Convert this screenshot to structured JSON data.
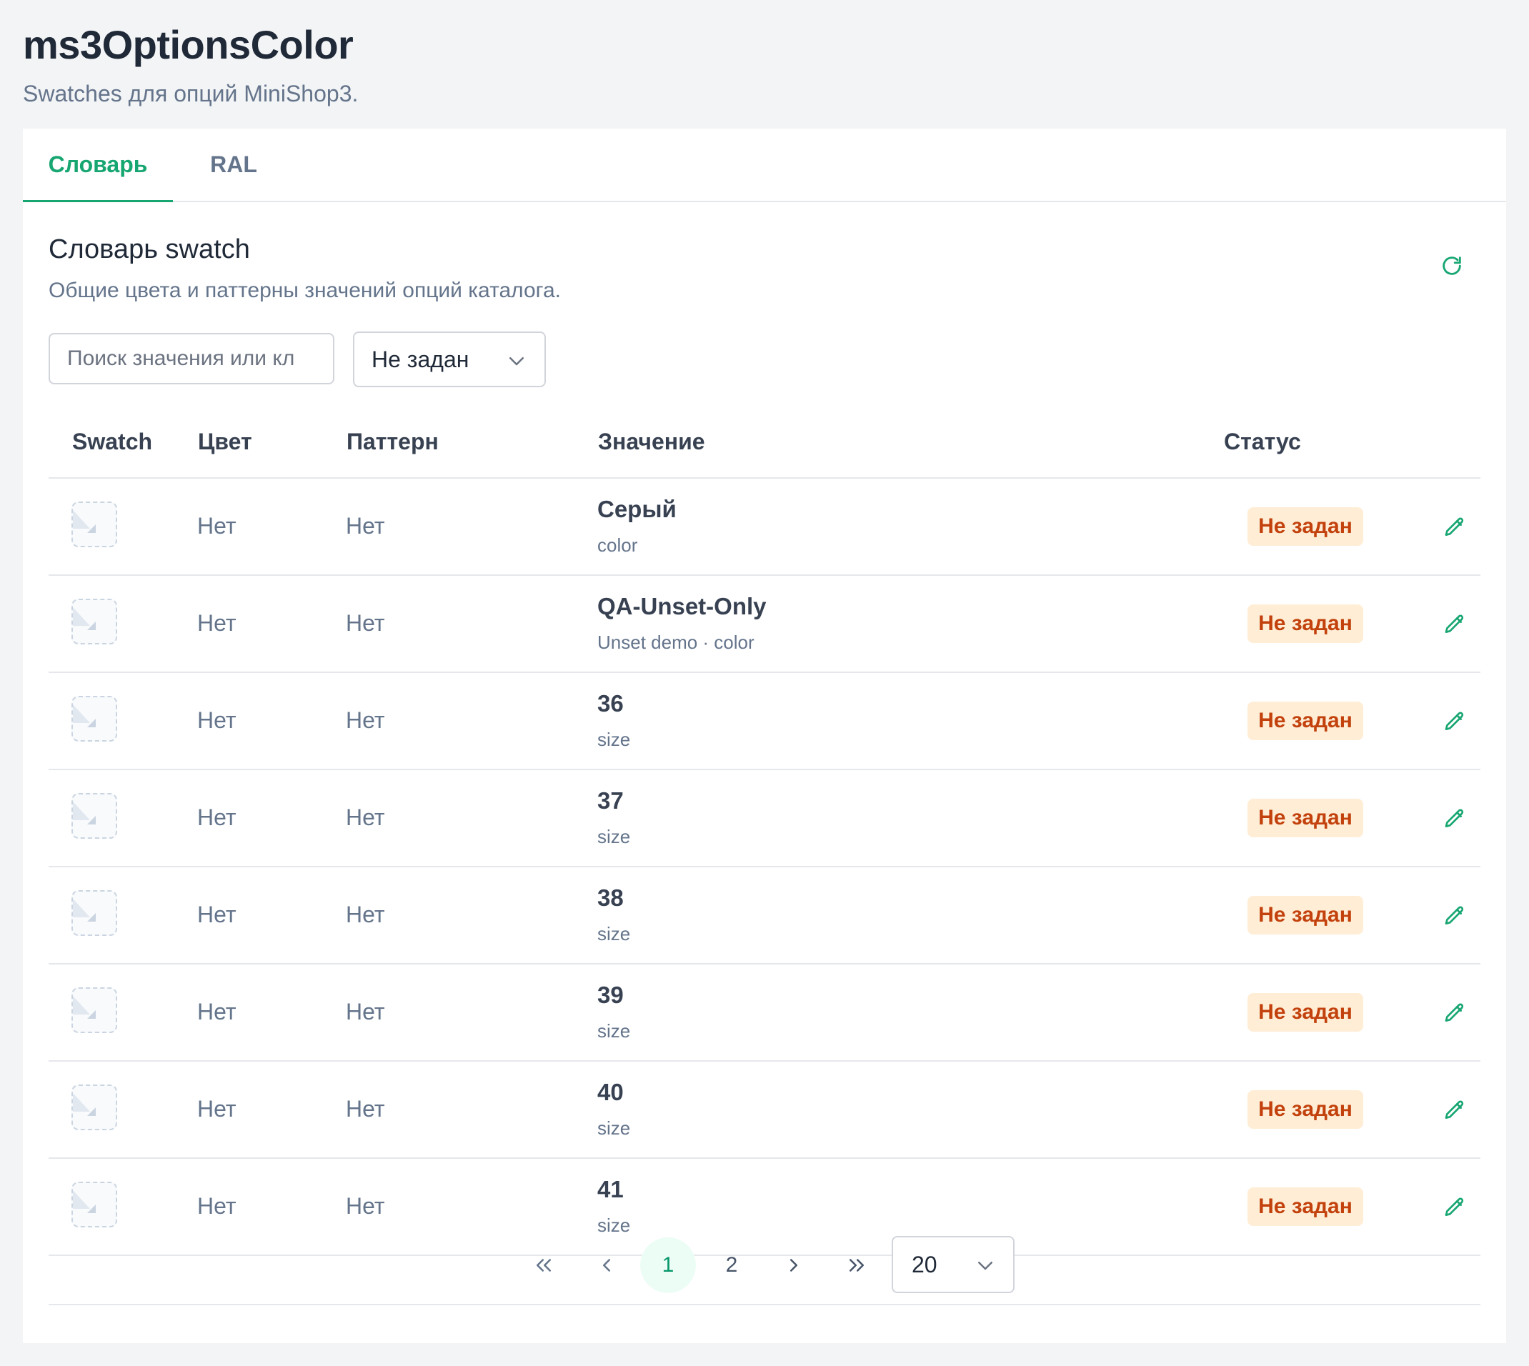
{
  "header": {
    "title": "ms3OptionsColor",
    "subtitle": "Swatches для опций MiniShop3."
  },
  "tabs": [
    {
      "label": "Словарь",
      "active": true
    },
    {
      "label": "RAL",
      "active": false
    }
  ],
  "section": {
    "title": "Словарь swatch",
    "description": "Общие цвета и паттерны значений опций каталога.",
    "refresh_icon": "refresh-icon"
  },
  "filters": {
    "search_placeholder": "Поиск значения или кл",
    "search_value": "",
    "status_selected": "Не задан",
    "dropdown_icon": "chevron-down-icon"
  },
  "table": {
    "columns": [
      "Swatch",
      "Цвет",
      "Паттерн",
      "Значение",
      "Статус"
    ],
    "rows": [
      {
        "color": "Нет",
        "pattern": "Нет",
        "value": "Серый",
        "meta": "color",
        "status": "Не задан"
      },
      {
        "color": "Нет",
        "pattern": "Нет",
        "value": "QA-Unset-Only",
        "meta": "Unset demo · color",
        "status": "Не задан"
      },
      {
        "color": "Нет",
        "pattern": "Нет",
        "value": "36",
        "meta": "size",
        "status": "Не задан"
      },
      {
        "color": "Нет",
        "pattern": "Нет",
        "value": "37",
        "meta": "size",
        "status": "Не задан"
      },
      {
        "color": "Нет",
        "pattern": "Нет",
        "value": "38",
        "meta": "size",
        "status": "Не задан"
      },
      {
        "color": "Нет",
        "pattern": "Нет",
        "value": "39",
        "meta": "size",
        "status": "Не задан"
      },
      {
        "color": "Нет",
        "pattern": "Нет",
        "value": "40",
        "meta": "size",
        "status": "Не задан"
      },
      {
        "color": "Нет",
        "pattern": "Нет",
        "value": "41",
        "meta": "size",
        "status": "Не задан"
      }
    ],
    "edit_icon": "pencil-icon",
    "swatch_icon": "empty-image-icon"
  },
  "pagination": {
    "first": "«",
    "prev": "‹",
    "pages": [
      "1",
      "2"
    ],
    "current_page": "1",
    "next": "›",
    "last": "»",
    "per_page": "20"
  },
  "colors": {
    "accent": "#17a672",
    "badge_bg": "#ffedd5",
    "badge_text": "#c2410c"
  }
}
